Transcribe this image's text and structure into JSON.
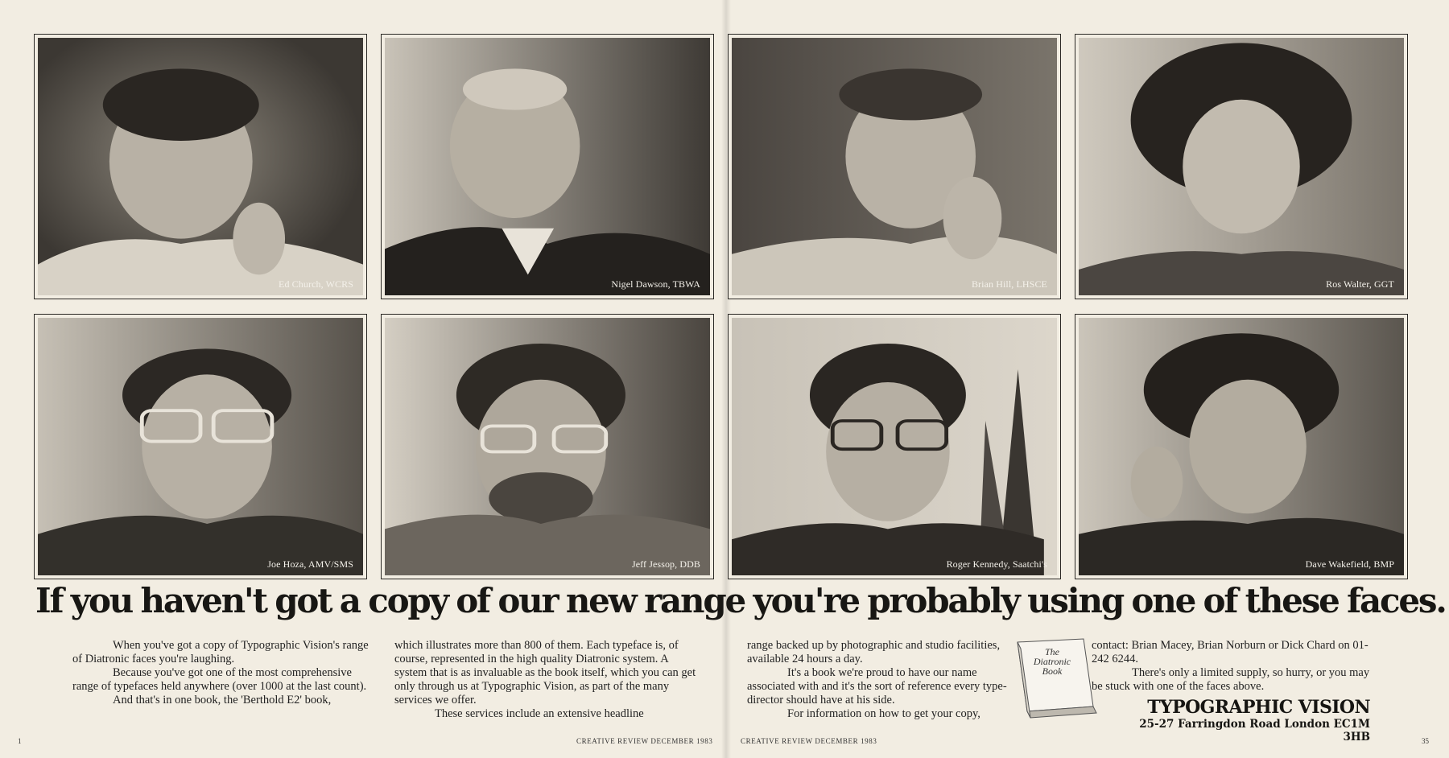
{
  "photos": [
    {
      "caption": "Ed Church, WCRS"
    },
    {
      "caption": "Nigel Dawson, TBWA"
    },
    {
      "caption": "Brian Hill, LHSCE"
    },
    {
      "caption": "Ros Walter, GGT"
    },
    {
      "caption": "Joe Hoza, AMV/SMS"
    },
    {
      "caption": "Jeff Jessop, DDB"
    },
    {
      "caption": "Roger Kennedy, Saatchi's"
    },
    {
      "caption": "Dave Wakefield, BMP"
    }
  ],
  "headline": "If you haven't got a copy of our new range you're probably using one of these faces.",
  "body": {
    "col1": [
      "When you've got a copy of Typographic Vision's range of Diatronic faces you're laughing.",
      "Because you've got one of the most comprehensive range of typefaces held anywhere (over 1000 at the last count).",
      "And that's in one book, the 'Berthold E2' book,"
    ],
    "col2": [
      "which illustrates more than 800 of them. Each typeface is, of course, represented in the high quality Diatronic system. A system that is as invaluable as the book itself, which you can get only through us at Typographic Vision, as part of the many services we offer.",
      "These services include an extensive headline"
    ],
    "col3": [
      "range backed up by photographic and studio facilities, available 24 hours a day.",
      "It's a book we're proud to have our name associated with and it's the sort of reference every type-director should have at his side.",
      "For information on how to get your copy,"
    ],
    "col4": [
      "contact: Brian Macey, Brian Norburn or Dick Chard on 01-242 6244.",
      "There's only a limited supply, so hurry, or you may be stuck with one of the faces above."
    ]
  },
  "book": {
    "title": "The Diatronic Book"
  },
  "brand": {
    "name": "TYPOGRAPHIC VISION",
    "address": "25-27 Farringdon Road London EC1M 3HB"
  },
  "footer": {
    "left_page": "1",
    "left_running": "CREATIVE REVIEW DECEMBER 1983",
    "right_running": "CREATIVE REVIEW DECEMBER 1983",
    "right_page": "35"
  }
}
